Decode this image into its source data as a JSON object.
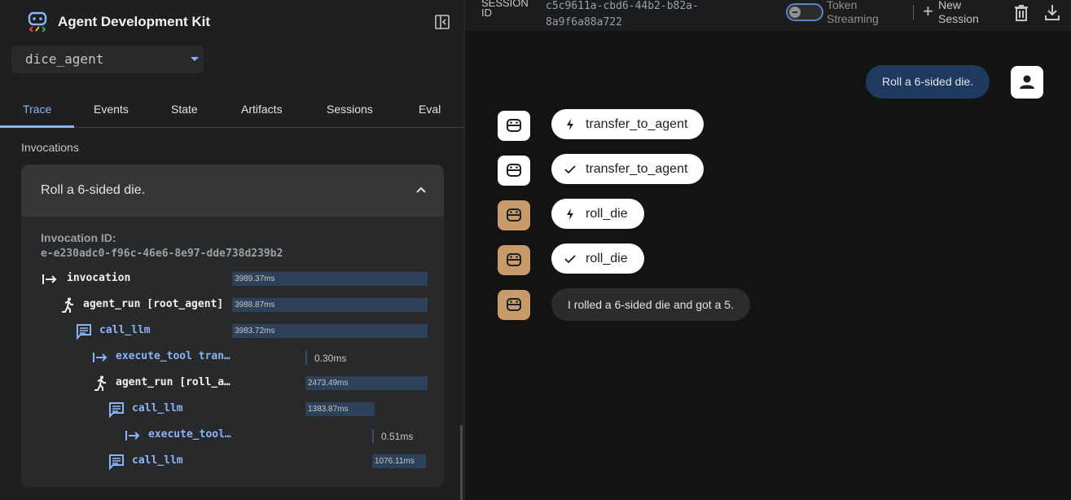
{
  "app": {
    "title": "Agent Development Kit",
    "selected_agent": "dice_agent"
  },
  "tabs": [
    {
      "label": "Trace",
      "active": true
    },
    {
      "label": "Events"
    },
    {
      "label": "State"
    },
    {
      "label": "Artifacts"
    },
    {
      "label": "Sessions"
    },
    {
      "label": "Eval"
    }
  ],
  "invocations": {
    "heading": "Invocations",
    "item": {
      "query": "Roll a 6-sided die.",
      "id_label": "Invocation ID:",
      "id_value": "e-e230adc0-f96c-46e6-8e97-dde738d239b2",
      "rows": [
        {
          "label": "invocation",
          "duration": "3989.37ms",
          "icon": "arrow-right-bar-icon"
        },
        {
          "label": "agent_run [root_agent]",
          "duration": "3988.87ms",
          "icon": "running-person-icon"
        },
        {
          "label": "call_llm",
          "duration": "3983.72ms",
          "icon": "chat-lines-icon"
        },
        {
          "label": "execute_tool tran…",
          "duration": "0.30ms",
          "icon": "arrow-right-bar-icon"
        },
        {
          "label": "agent_run [roll_a…",
          "duration": "2473.49ms",
          "icon": "running-person-icon"
        },
        {
          "label": "call_llm",
          "duration": "1383.87ms",
          "icon": "chat-lines-icon"
        },
        {
          "label": "execute_tool…",
          "duration": "0.51ms",
          "icon": "arrow-right-bar-icon"
        },
        {
          "label": "call_llm",
          "duration": "1076.11ms",
          "icon": "chat-lines-icon"
        }
      ]
    }
  },
  "session": {
    "label": "SESSION ID",
    "id": "c5c9611a-cbd6-44b2-b82a-8a9f6a88a722",
    "token_streaming_label": "Token Streaming",
    "new_session_label": "New Session"
  },
  "chat": {
    "user_message": "Roll a 6-sided die.",
    "events": [
      {
        "kind": "function_call",
        "name": "transfer_to_agent",
        "avatar": "white"
      },
      {
        "kind": "function_response",
        "name": "transfer_to_agent",
        "avatar": "white"
      },
      {
        "kind": "function_call",
        "name": "roll_die",
        "avatar": "tan"
      },
      {
        "kind": "function_response",
        "name": "roll_die",
        "avatar": "tan"
      }
    ],
    "bot_message": "I rolled a 6-sided die and got a 5."
  },
  "colors": {
    "accent": "#8ab4f8",
    "bar": "#2d4159",
    "user_bubble": "#1e3a5f",
    "agent_tan": "#c79b6a"
  }
}
